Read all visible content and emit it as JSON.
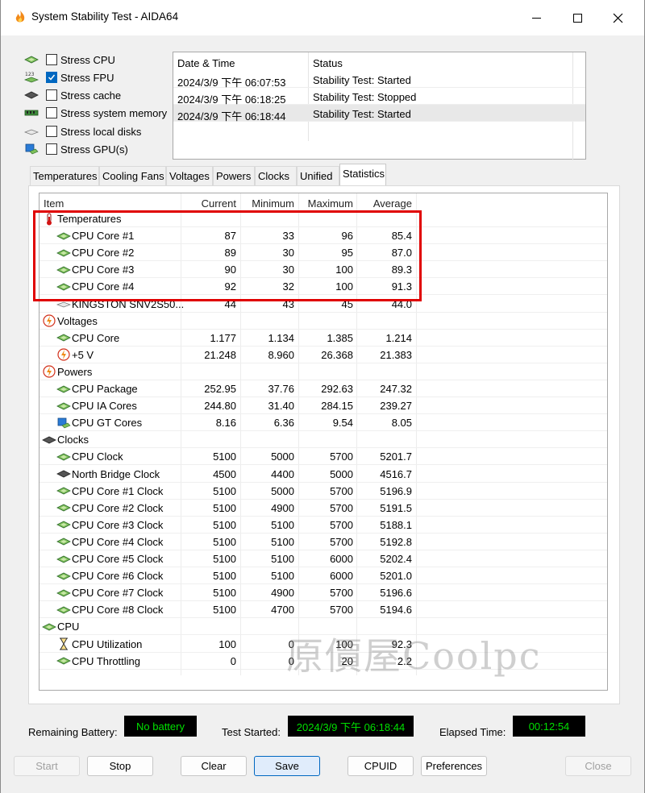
{
  "window": {
    "title": "System Stability Test - AIDA64"
  },
  "stress_options": [
    {
      "label": "Stress CPU",
      "checked": false,
      "icon": "cpu-chip-icon"
    },
    {
      "label": "Stress FPU",
      "checked": true,
      "icon": "fpu-icon"
    },
    {
      "label": "Stress cache",
      "checked": false,
      "icon": "cache-icon"
    },
    {
      "label": "Stress system memory",
      "checked": false,
      "icon": "memory-icon"
    },
    {
      "label": "Stress local disks",
      "checked": false,
      "icon": "disk-icon"
    },
    {
      "label": "Stress GPU(s)",
      "checked": false,
      "icon": "gpu-icon"
    }
  ],
  "fpu_icon_text": "123",
  "log": {
    "headers": {
      "datetime": "Date & Time",
      "status": "Status"
    },
    "rows": [
      {
        "datetime": "2024/3/9 下午 06:07:53",
        "status": "Stability Test: Started"
      },
      {
        "datetime": "2024/3/9 下午 06:18:25",
        "status": "Stability Test: Stopped"
      },
      {
        "datetime": "2024/3/9 下午 06:18:44",
        "status": "Stability Test: Started",
        "selected": true
      }
    ]
  },
  "tabs": [
    "Temperatures",
    "Cooling Fans",
    "Voltages",
    "Powers",
    "Clocks",
    "Unified",
    "Statistics"
  ],
  "active_tab": "Statistics",
  "stats": {
    "headers": {
      "item": "Item",
      "current": "Current",
      "minimum": "Minimum",
      "maximum": "Maximum",
      "average": "Average"
    },
    "rows": [
      {
        "group": true,
        "icon": "thermometer-icon",
        "item": "Temperatures"
      },
      {
        "icon": "cpu-chip-icon",
        "item": "CPU Core #1",
        "current": "87",
        "minimum": "33",
        "maximum": "96",
        "average": "85.4"
      },
      {
        "icon": "cpu-chip-icon",
        "item": "CPU Core #2",
        "current": "89",
        "minimum": "30",
        "maximum": "95",
        "average": "87.0"
      },
      {
        "icon": "cpu-chip-icon",
        "item": "CPU Core #3",
        "current": "90",
        "minimum": "30",
        "maximum": "100",
        "average": "89.3"
      },
      {
        "icon": "cpu-chip-icon",
        "item": "CPU Core #4",
        "current": "92",
        "minimum": "32",
        "maximum": "100",
        "average": "91.3"
      },
      {
        "icon": "disk-icon",
        "item": "KINGSTON SNV2S50...",
        "current": "44",
        "minimum": "43",
        "maximum": "45",
        "average": "44.0"
      },
      {
        "group": true,
        "icon": "lightning-icon",
        "item": "Voltages"
      },
      {
        "icon": "cpu-chip-icon",
        "item": "CPU Core",
        "current": "1.177",
        "minimum": "1.134",
        "maximum": "1.385",
        "average": "1.214"
      },
      {
        "icon": "lightning-icon",
        "item": "+5 V",
        "current": "21.248",
        "minimum": "8.960",
        "maximum": "26.368",
        "average": "21.383"
      },
      {
        "group": true,
        "icon": "lightning-icon",
        "item": "Powers"
      },
      {
        "icon": "cpu-chip-icon",
        "item": "CPU Package",
        "current": "252.95",
        "minimum": "37.76",
        "maximum": "292.63",
        "average": "247.32"
      },
      {
        "icon": "cpu-chip-icon",
        "item": "CPU IA Cores",
        "current": "244.80",
        "minimum": "31.40",
        "maximum": "284.15",
        "average": "239.27"
      },
      {
        "icon": "gpu-icon",
        "item": "CPU GT Cores",
        "current": "8.16",
        "minimum": "6.36",
        "maximum": "9.54",
        "average": "8.05"
      },
      {
        "group": true,
        "icon": "clock-chip-icon",
        "item": "Clocks"
      },
      {
        "icon": "cpu-chip-icon",
        "item": "CPU Clock",
        "current": "5100",
        "minimum": "5000",
        "maximum": "5700",
        "average": "5201.7"
      },
      {
        "icon": "northbridge-icon",
        "item": "North Bridge Clock",
        "current": "4500",
        "minimum": "4400",
        "maximum": "5000",
        "average": "4516.7"
      },
      {
        "icon": "cpu-chip-icon",
        "item": "CPU Core #1 Clock",
        "current": "5100",
        "minimum": "5000",
        "maximum": "5700",
        "average": "5196.9"
      },
      {
        "icon": "cpu-chip-icon",
        "item": "CPU Core #2 Clock",
        "current": "5100",
        "minimum": "4900",
        "maximum": "5700",
        "average": "5191.5"
      },
      {
        "icon": "cpu-chip-icon",
        "item": "CPU Core #3 Clock",
        "current": "5100",
        "minimum": "5100",
        "maximum": "5700",
        "average": "5188.1"
      },
      {
        "icon": "cpu-chip-icon",
        "item": "CPU Core #4 Clock",
        "current": "5100",
        "minimum": "5100",
        "maximum": "5700",
        "average": "5192.8"
      },
      {
        "icon": "cpu-chip-icon",
        "item": "CPU Core #5 Clock",
        "current": "5100",
        "minimum": "5100",
        "maximum": "6000",
        "average": "5202.4"
      },
      {
        "icon": "cpu-chip-icon",
        "item": "CPU Core #6 Clock",
        "current": "5100",
        "minimum": "5100",
        "maximum": "6000",
        "average": "5201.0"
      },
      {
        "icon": "cpu-chip-icon",
        "item": "CPU Core #7 Clock",
        "current": "5100",
        "minimum": "4900",
        "maximum": "5700",
        "average": "5196.6"
      },
      {
        "icon": "cpu-chip-icon",
        "item": "CPU Core #8 Clock",
        "current": "5100",
        "minimum": "4700",
        "maximum": "5700",
        "average": "5194.6"
      },
      {
        "group": true,
        "icon": "cpu-chip-icon",
        "item": "CPU"
      },
      {
        "icon": "hourglass-icon",
        "item": "CPU Utilization",
        "current": "100",
        "minimum": "0",
        "maximum": "100",
        "average": "92.3"
      },
      {
        "icon": "cpu-chip-icon",
        "item": "CPU Throttling",
        "current": "0",
        "minimum": "0",
        "maximum": "20",
        "average": "2.2"
      }
    ]
  },
  "watermark": "原價屋Coolpc",
  "status": {
    "battery_label": "Remaining Battery:",
    "battery_value": "No battery",
    "started_label": "Test Started:",
    "started_value": "2024/3/9 下午 06:18:44",
    "elapsed_label": "Elapsed Time:",
    "elapsed_value": "00:12:54"
  },
  "buttons": {
    "start": "Start",
    "stop": "Stop",
    "clear": "Clear",
    "save": "Save",
    "cpuid": "CPUID",
    "preferences": "Preferences",
    "close": "Close"
  },
  "colors": {
    "accent": "#0067c0",
    "highlight_box": "#e00000",
    "status_text": "#00e000",
    "status_bg": "#000000"
  }
}
